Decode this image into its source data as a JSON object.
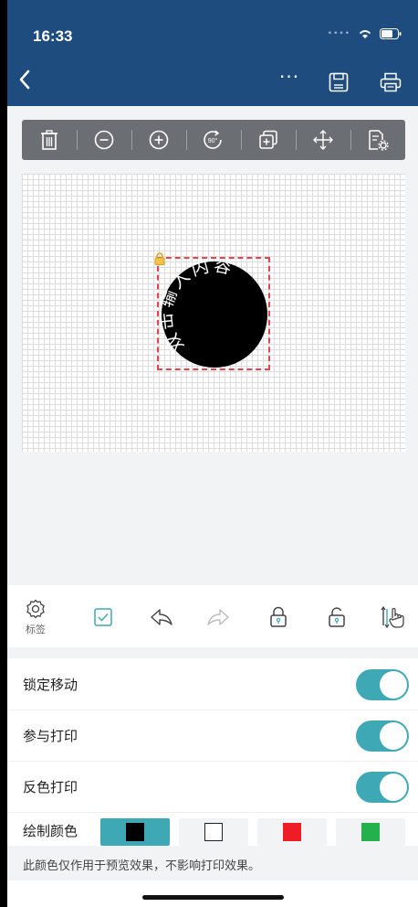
{
  "status_bar": {
    "time": "16:33"
  },
  "nav": {
    "back_icon": "chevron-left-icon",
    "more_label": "···",
    "save_icon": "floppy-disk-icon",
    "print_icon": "printer-icon"
  },
  "toolbar": {
    "tools": [
      "trash-icon",
      "zoom-out-icon",
      "zoom-in-icon",
      "rotate-90-icon",
      "duplicate-icon",
      "move-icon",
      "properties-icon"
    ],
    "rotate_text": "90°"
  },
  "canvas": {
    "stamp_text": "双击输入内容",
    "stamp_color": "#000000",
    "selection_color": "#e04550"
  },
  "icon_bar": {
    "settings_label": "标签",
    "icons": [
      "gear-icon",
      "checkbox-icon",
      "undo-icon",
      "redo-icon",
      "lock-icon",
      "unlock-icon",
      "touch-sort-icon"
    ]
  },
  "settings": {
    "lock_move": {
      "label": "锁定移动",
      "enabled": true
    },
    "participate_print": {
      "label": "参与打印",
      "enabled": true
    },
    "invert_print": {
      "label": "反色打印",
      "enabled": true
    }
  },
  "draw_color": {
    "label": "绘制颜色",
    "options": [
      {
        "name": "black",
        "chip": "#000000",
        "selected": true
      },
      {
        "name": "white",
        "chip": "#ffffff",
        "selected": false
      },
      {
        "name": "red",
        "chip": "#ee1c25",
        "selected": false
      },
      {
        "name": "green",
        "chip": "#22b14c",
        "selected": false
      }
    ],
    "accent": "#3ea8b5"
  },
  "note": "此颜色仅作用于预览效果，不影响打印效果。"
}
